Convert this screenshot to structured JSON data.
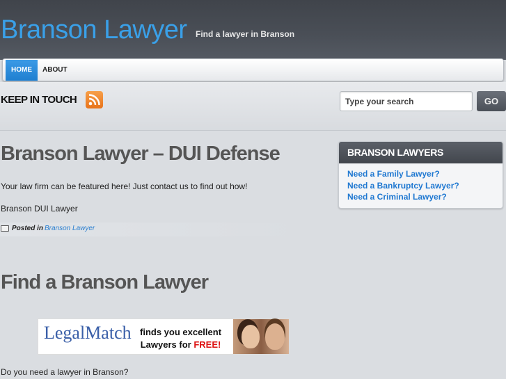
{
  "header": {
    "site_title": "Branson Lawyer",
    "site_description": "Find a lawyer in Branson"
  },
  "nav": {
    "items": [
      {
        "label": "HOME",
        "active": true
      },
      {
        "label": "ABOUT",
        "active": false
      }
    ]
  },
  "social": {
    "keep_in_touch": "KEEP IN TOUCH",
    "icon": "rss-icon"
  },
  "search": {
    "placeholder": "Type your search",
    "button_label": "GO"
  },
  "posts": [
    {
      "title": "Branson Lawyer – DUI Defense",
      "paragraphs": [
        "Your law firm can be featured here! Just contact us to find out how!",
        "Branson DUI Lawyer"
      ],
      "posted_label": "Posted in",
      "category": "Branson Lawyer"
    },
    {
      "title": "Find a Branson Lawyer",
      "banner": {
        "logo": "LegalMatch",
        "line1": "finds you excellent",
        "line2": "Lawyers for",
        "free": "FREE!"
      },
      "paragraphs": [
        "Do you need a lawyer in Branson?"
      ]
    }
  ],
  "sidebar": {
    "widget_title": "BRANSON LAWYERS",
    "links": [
      "Need a Family Lawyer?",
      "Need a Bankruptcy Lawyer?",
      "Need a Criminal Lawyer?"
    ]
  },
  "colors": {
    "accent": "#1f7fd0",
    "title_blue": "#3aa0e8",
    "link": "#1f78d1",
    "header_bg": "#4a4f57"
  }
}
